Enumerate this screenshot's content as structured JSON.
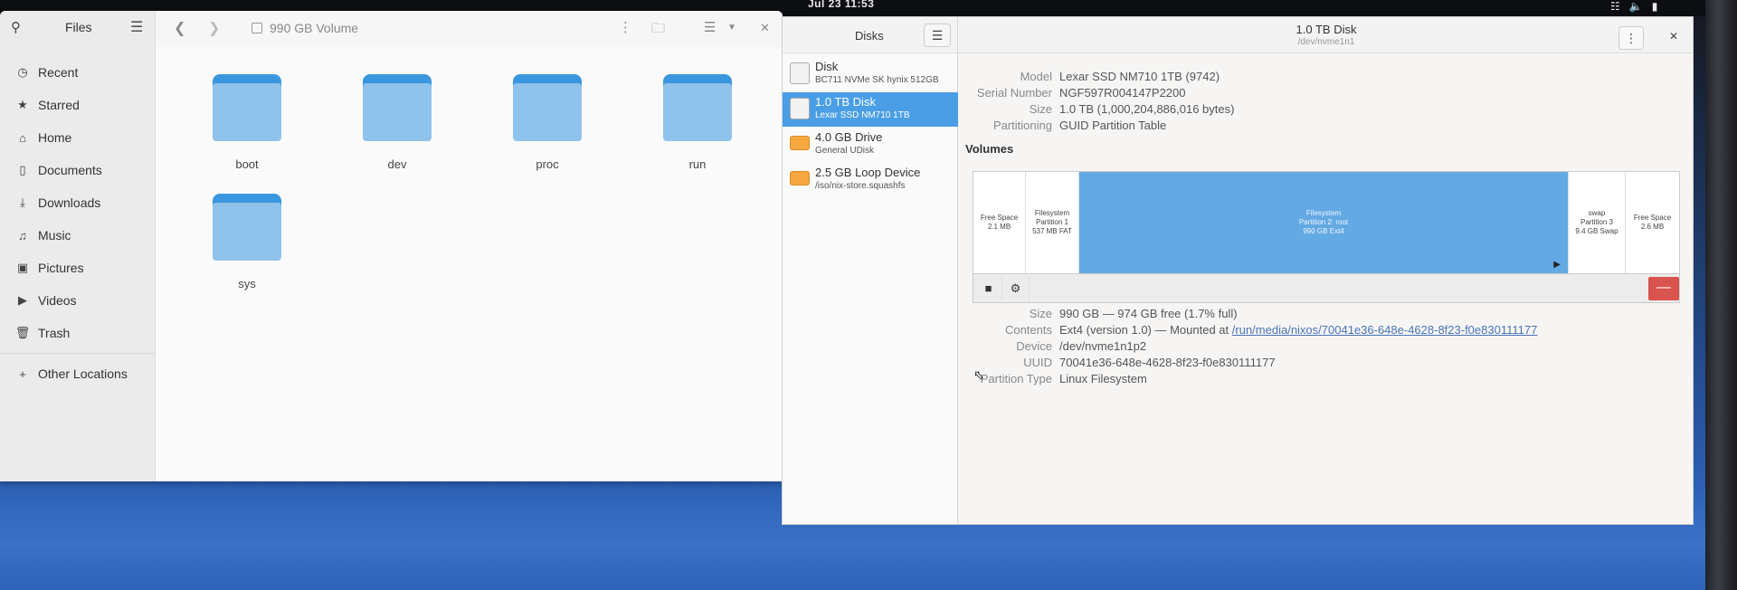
{
  "topbar": {
    "clock": "Jul 23  11:53"
  },
  "files": {
    "app_title": "Files",
    "location": "990 GB Volume",
    "sidebar": [
      {
        "label": "Recent",
        "icon": "clock-icon"
      },
      {
        "label": "Starred",
        "icon": "star-icon"
      },
      {
        "label": "Home",
        "icon": "home-icon"
      },
      {
        "label": "Documents",
        "icon": "document-icon"
      },
      {
        "label": "Downloads",
        "icon": "download-icon"
      },
      {
        "label": "Music",
        "icon": "music-icon"
      },
      {
        "label": "Pictures",
        "icon": "picture-icon"
      },
      {
        "label": "Videos",
        "icon": "video-icon"
      },
      {
        "label": "Trash",
        "icon": "trash-icon"
      }
    ],
    "other_locations": "Other Locations",
    "folders": [
      "boot",
      "dev",
      "proc",
      "run",
      "sys"
    ]
  },
  "disks": {
    "app_title": "Disks",
    "drives": [
      {
        "name": "Disk",
        "sub": "BC711 NVMe SK hynix 512GB"
      },
      {
        "name": "1.0 TB Disk",
        "sub": "Lexar SSD NM710 1TB"
      },
      {
        "name": "4.0 GB Drive",
        "sub": "General UDisk"
      },
      {
        "name": "2.5 GB Loop Device",
        "sub": "/iso/nix-store.squashfs"
      }
    ],
    "header": {
      "title": "1.0 TB Disk",
      "subtitle": "/dev/nvme1n1"
    },
    "info": {
      "model_label": "Model",
      "model": "Lexar SSD NM710 1TB (9742)",
      "serial_label": "Serial Number",
      "serial": "NGF597R004147P2200",
      "size_label": "Size",
      "size": "1.0 TB (1,000,204,886,016 bytes)",
      "partitioning_label": "Partitioning",
      "partitioning": "GUID Partition Table"
    },
    "volumes_heading": "Volumes",
    "segments": [
      {
        "l1": "Free Space",
        "l2": "2.1 MB",
        "l3": ""
      },
      {
        "l1": "Filesystem",
        "l2": "Partition 1",
        "l3": "537 MB FAT"
      },
      {
        "l1": "Filesystem",
        "l2": "Partition 2: root",
        "l3": "990 GB Ext4"
      },
      {
        "l1": "swap",
        "l2": "Partition 3",
        "l3": "9.4 GB Swap"
      },
      {
        "l1": "Free Space",
        "l2": "2.6 MB",
        "l3": ""
      }
    ],
    "volume": {
      "size_label": "Size",
      "size": "990 GB — 974 GB free (1.7% full)",
      "contents_label": "Contents",
      "contents_prefix": "Ext4 (version 1.0) — Mounted at",
      "mount_path": "/run/media/nixos/70041e36-648e-4628-8f23-f0e830111177",
      "device_label": "Device",
      "device": "/dev/nvme1n1p2",
      "uuid_label": "UUID",
      "uuid": "70041e36-648e-4628-8f23-f0e830111177",
      "ptype_label": "Partition Type",
      "ptype": "Linux Filesystem"
    }
  }
}
